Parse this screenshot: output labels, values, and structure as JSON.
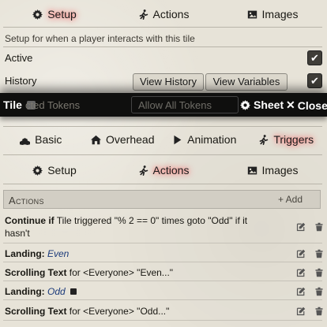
{
  "background_window": {
    "tabs": [
      {
        "label": "Setup",
        "icon": "gear-icon",
        "active": true
      },
      {
        "label": "Actions",
        "icon": "running-icon",
        "active": false
      },
      {
        "label": "Images",
        "icon": "image-icon",
        "active": false
      }
    ],
    "description": "Setup for when a player interacts with this tile",
    "active_label": "Active",
    "history_label": "History",
    "view_history_label": "View History",
    "view_variables_label": "View Variables"
  },
  "header": {
    "title": "Tile",
    "obscured_text": "cted Tokens",
    "allow_tokens_label": "Allow All Tokens",
    "sheet_label": "Sheet",
    "close_label": "Close"
  },
  "main_tabs": [
    {
      "label": "Basic",
      "icon": "cubes-icon",
      "active": false
    },
    {
      "label": "Overhead",
      "icon": "home-icon",
      "active": false
    },
    {
      "label": "Animation",
      "icon": "play-icon",
      "active": false
    },
    {
      "label": "Triggers",
      "icon": "running-icon",
      "active": true
    }
  ],
  "sub_tabs": [
    {
      "label": "Setup",
      "icon": "gear-icon",
      "active": false
    },
    {
      "label": "Actions",
      "icon": "running-icon",
      "active": true
    },
    {
      "label": "Images",
      "icon": "image-icon",
      "active": false
    }
  ],
  "actions": {
    "title": "Actions",
    "add_label": "+ Add",
    "rows": [
      {
        "bold": "Continue if",
        "rest": " Tile triggered \"% 2 == 0\" times goto \"Odd\" if it hasn't"
      },
      {
        "bold": "Landing:",
        "italic": "Even"
      },
      {
        "bold": "Scrolling Text",
        "rest": " for <Everyone> \"Even...\""
      },
      {
        "bold": "Landing:",
        "italic": "Odd"
      },
      {
        "bold": "Scrolling Text",
        "rest": " for <Everyone> \"Odd...\""
      }
    ]
  },
  "colors": {
    "header_bg": "#0f0f0e",
    "active_glow": "#ff6a6a",
    "italic_text": "#1b3a7a"
  }
}
